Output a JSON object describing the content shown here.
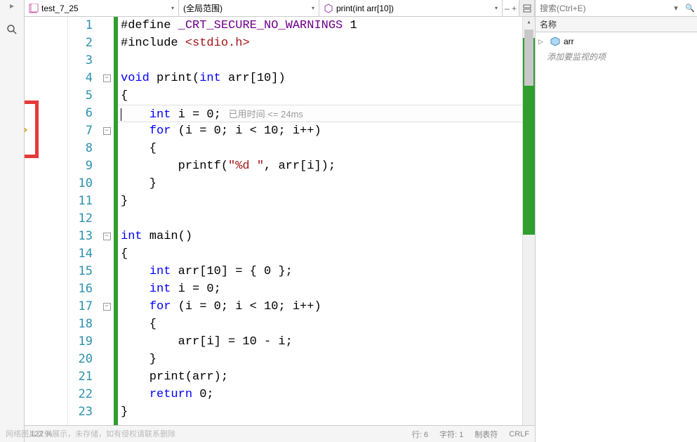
{
  "topbar": {
    "file": "test_7_25",
    "scope": "(全局范围)",
    "member": "print(int arr[10])"
  },
  "code": {
    "lines": [
      {
        "n": 1,
        "fold": "",
        "segs": [
          {
            "t": "#define ",
            "c": ""
          },
          {
            "t": "_CRT_SECURE_NO_WARNINGS",
            "c": "macro"
          },
          {
            "t": " 1",
            "c": ""
          }
        ]
      },
      {
        "n": 2,
        "fold": "",
        "segs": [
          {
            "t": "#include ",
            "c": ""
          },
          {
            "t": "<stdio.h>",
            "c": "inc"
          }
        ]
      },
      {
        "n": 3,
        "fold": "",
        "segs": []
      },
      {
        "n": 4,
        "fold": "-",
        "segs": [
          {
            "t": "void",
            "c": "kw"
          },
          {
            "t": " print(",
            "c": ""
          },
          {
            "t": "int",
            "c": "kw"
          },
          {
            "t": " arr[10])",
            "c": ""
          }
        ]
      },
      {
        "n": 5,
        "fold": "",
        "segs": [
          {
            "t": "{",
            "c": ""
          }
        ]
      },
      {
        "n": 6,
        "fold": "",
        "current": true,
        "segs": [
          {
            "t": "    ",
            "c": ""
          },
          {
            "t": "int",
            "c": "kw"
          },
          {
            "t": " i = 0;",
            "c": ""
          }
        ],
        "hint": "   已用时间 <= 24ms"
      },
      {
        "n": 7,
        "fold": "-",
        "segs": [
          {
            "t": "    ",
            "c": ""
          },
          {
            "t": "for",
            "c": "kw"
          },
          {
            "t": " (i = 0; i < 10; i++)",
            "c": ""
          }
        ]
      },
      {
        "n": 8,
        "fold": "",
        "segs": [
          {
            "t": "    {",
            "c": ""
          }
        ]
      },
      {
        "n": 9,
        "fold": "",
        "segs": [
          {
            "t": "        printf(",
            "c": ""
          },
          {
            "t": "\"%d \"",
            "c": "str"
          },
          {
            "t": ", arr[i]);",
            "c": ""
          }
        ]
      },
      {
        "n": 10,
        "fold": "",
        "segs": [
          {
            "t": "    }",
            "c": ""
          }
        ]
      },
      {
        "n": 11,
        "fold": "",
        "segs": [
          {
            "t": "}",
            "c": ""
          }
        ]
      },
      {
        "n": 12,
        "fold": "",
        "segs": []
      },
      {
        "n": 13,
        "fold": "-",
        "segs": [
          {
            "t": "int",
            "c": "kw"
          },
          {
            "t": " main()",
            "c": ""
          }
        ]
      },
      {
        "n": 14,
        "fold": "",
        "segs": [
          {
            "t": "{",
            "c": ""
          }
        ]
      },
      {
        "n": 15,
        "fold": "",
        "segs": [
          {
            "t": "    ",
            "c": ""
          },
          {
            "t": "int",
            "c": "kw"
          },
          {
            "t": " arr[10] = { 0 };",
            "c": ""
          }
        ]
      },
      {
        "n": 16,
        "fold": "",
        "segs": [
          {
            "t": "    ",
            "c": ""
          },
          {
            "t": "int",
            "c": "kw"
          },
          {
            "t": " i = 0;",
            "c": ""
          }
        ]
      },
      {
        "n": 17,
        "fold": "-",
        "segs": [
          {
            "t": "    ",
            "c": ""
          },
          {
            "t": "for",
            "c": "kw"
          },
          {
            "t": " (i = 0; i < 10; i++)",
            "c": ""
          }
        ]
      },
      {
        "n": 18,
        "fold": "",
        "segs": [
          {
            "t": "    {",
            "c": ""
          }
        ]
      },
      {
        "n": 19,
        "fold": "",
        "segs": [
          {
            "t": "        arr[i] = 10 - i;",
            "c": ""
          }
        ]
      },
      {
        "n": 20,
        "fold": "",
        "segs": [
          {
            "t": "    }",
            "c": ""
          }
        ]
      },
      {
        "n": 21,
        "fold": "",
        "segs": [
          {
            "t": "    print(arr);",
            "c": ""
          }
        ]
      },
      {
        "n": 22,
        "fold": "",
        "segs": [
          {
            "t": "    ",
            "c": ""
          },
          {
            "t": "return",
            "c": "kw"
          },
          {
            "t": " 0;",
            "c": ""
          }
        ]
      },
      {
        "n": 23,
        "fold": "",
        "segs": [
          {
            "t": "}",
            "c": ""
          }
        ]
      }
    ]
  },
  "watch": {
    "search_placeholder": "搜索(Ctrl+E)",
    "header_name": "名称",
    "items": [
      {
        "name": "arr"
      }
    ],
    "add_hint": "添加要监视的项"
  },
  "status": {
    "watermark": "网络图片仅供展示，未存储，如有侵权请联系删除",
    "zoom": "122 %",
    "line": "行: 6",
    "col": "字符: 1",
    "tabs": "制表符",
    "crlf": "CRLF"
  }
}
